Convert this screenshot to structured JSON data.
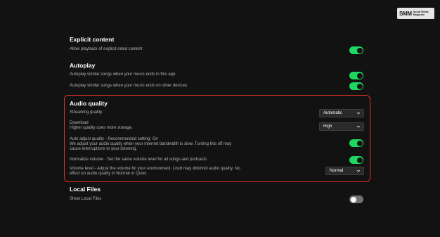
{
  "watermark": {
    "big": "SMM",
    "small_line1": "Social Media",
    "small_line2": "Magazine"
  },
  "explicit": {
    "title": "Explicit content",
    "allow_label": "Allow playback of explicit-rated content"
  },
  "autoplay": {
    "title": "Autoplay",
    "this_app_label": "Autoplay similar songs when your music ends in this app",
    "other_devices_label": "Autoplay similar songs when your music ends on other devices"
  },
  "audio_quality": {
    "title": "Audio quality",
    "streaming_label": "Streaming quality",
    "streaming_value": "Automatic",
    "download_label": "Download",
    "download_sub": "Higher quality uses more storage.",
    "download_value": "High",
    "auto_adjust_line1": "Auto adjust quality - Recommended setting: On",
    "auto_adjust_line2": "We adjust your audio quality when your internet bandwidth is slow. Turning this off may",
    "auto_adjust_line3": "cause interruptions to your listening.",
    "normalize_label": "Normalize volume - Set the same volume level for all songs and podcasts",
    "volume_line1": "Volume level - Adjust the volume for your environment. Loud may diminish audio quality. No",
    "volume_line2": "effect on audio quality in Normal or Quiet.",
    "volume_value": "Normal"
  },
  "local_files": {
    "title": "Local Files",
    "show_label": "Show Local Files"
  },
  "toggles": {
    "explicit": true,
    "autoplay_this_app": true,
    "autoplay_other_devices": true,
    "auto_adjust": true,
    "normalize": true,
    "show_local_files": false
  },
  "colors": {
    "background": "#121212",
    "accent": "#1ed760",
    "highlight": "#e0312c"
  }
}
